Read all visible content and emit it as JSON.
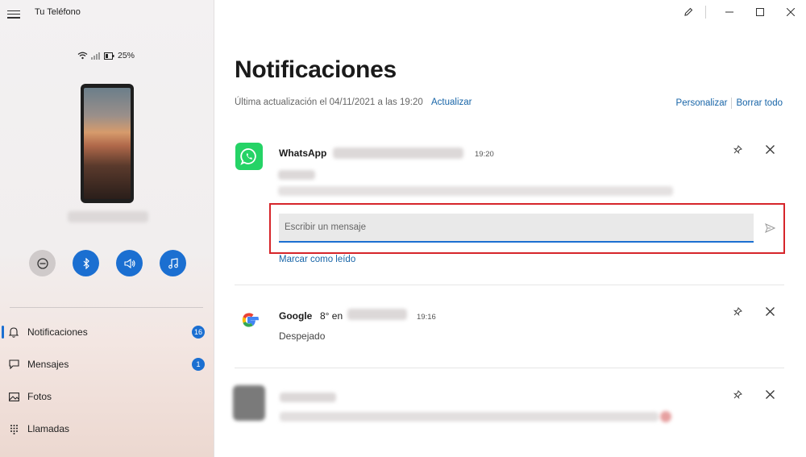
{
  "app": {
    "title": "Tu Teléfono"
  },
  "phone_status": {
    "battery": "25%",
    "icons": [
      "wifi-icon",
      "signal-icon",
      "battery-icon"
    ]
  },
  "quick_actions": [
    {
      "name": "do-not-disturb-button",
      "icon": "minus-circle-icon"
    },
    {
      "name": "bluetooth-button",
      "icon": "bluetooth-icon"
    },
    {
      "name": "volume-button",
      "icon": "speaker-icon"
    },
    {
      "name": "music-button",
      "icon": "music-note-icon"
    }
  ],
  "nav": {
    "items": [
      {
        "label": "Notificaciones",
        "icon": "bell-icon",
        "badge": "16"
      },
      {
        "label": "Mensajes",
        "icon": "message-icon",
        "badge": "1"
      },
      {
        "label": "Fotos",
        "icon": "photo-icon"
      },
      {
        "label": "Llamadas",
        "icon": "dialpad-icon"
      }
    ]
  },
  "main": {
    "title": "Notificaciones",
    "last_update": "Última actualización el 04/11/2021 a las 19:20",
    "refresh_label": "Actualizar",
    "customize_label": "Personalizar",
    "clear_all_label": "Borrar todo"
  },
  "notifications": [
    {
      "app": "WhatsApp",
      "time": "19:20",
      "icon": "whatsapp-icon",
      "reply_placeholder": "Escribir un mensaje",
      "mark_read_label": "Marcar como leído"
    },
    {
      "app": "Google",
      "title_fragment": "8° en",
      "time": "19:16",
      "body": "Despejado",
      "icon": "google-icon"
    },
    {
      "icon": "blurred-app-icon"
    }
  ],
  "colors": {
    "accent": "#1b6fd1",
    "whatsapp": "#25d366",
    "highlight": "#d6252a",
    "link": "#1865a8"
  }
}
